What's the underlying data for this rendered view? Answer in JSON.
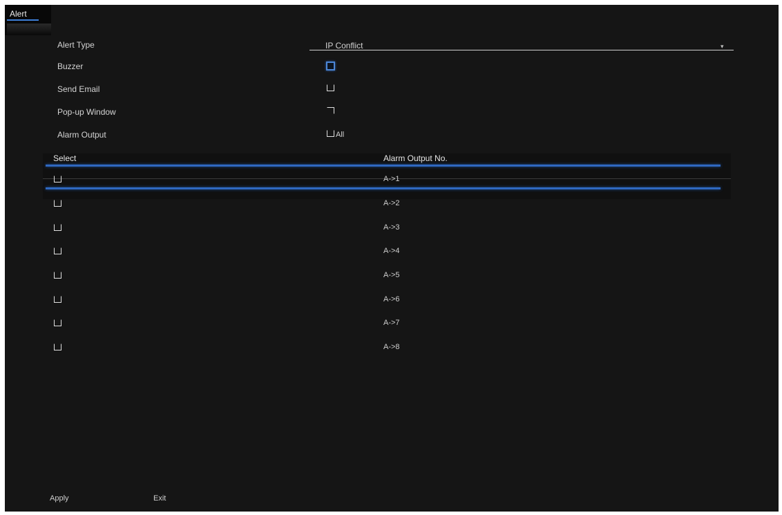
{
  "tab": {
    "label": "Alert"
  },
  "form": {
    "alert_type_label": "Alert Type",
    "alert_type_value": "IP Conflict",
    "buzzer_label": "Buzzer",
    "send_email_label": "Send Email",
    "popup_label": "Pop-up Window",
    "alarm_output_label": "Alarm Output",
    "alarm_output_all": "All"
  },
  "table": {
    "headers": {
      "select": "Select",
      "output": "Alarm Output No."
    },
    "rows": [
      {
        "output": "A->1"
      },
      {
        "output": "A->2"
      },
      {
        "output": "A->3"
      },
      {
        "output": "A->4"
      },
      {
        "output": "A->5"
      },
      {
        "output": "A->6"
      },
      {
        "output": "A->7"
      },
      {
        "output": "A->8"
      }
    ]
  },
  "buttons": {
    "apply": "Apply",
    "exit": "Exit"
  },
  "icons": {
    "dropdown": "chevron-down-icon"
  },
  "colors": {
    "accent": "#2f68c0",
    "background": "#151515"
  }
}
